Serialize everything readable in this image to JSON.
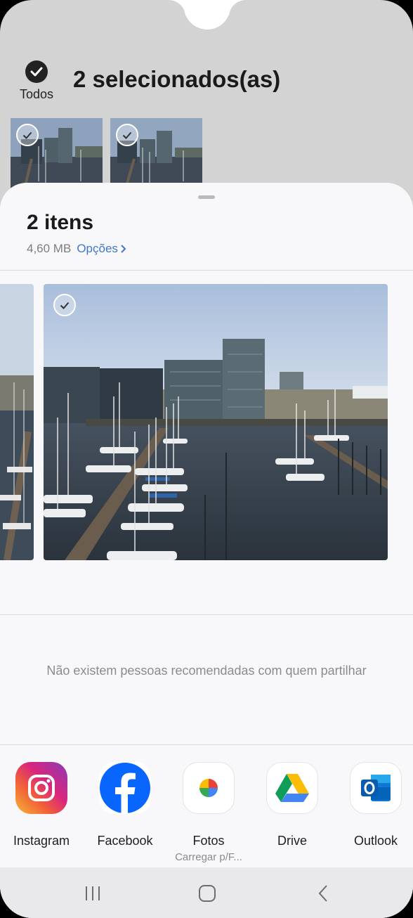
{
  "gallery": {
    "select_all_label": "Todos",
    "selection_title": "2 selecionados(as)"
  },
  "sheet": {
    "title": "2 itens",
    "size": "4,60 MB",
    "options_label": "Opções",
    "no_people_text": "Não existem pessoas recomendadas com quem partilhar"
  },
  "apps": [
    {
      "name": "Instagram",
      "sub": "",
      "icon": "instagram-icon"
    },
    {
      "name": "Facebook",
      "sub": "",
      "icon": "facebook-icon"
    },
    {
      "name": "Fotos",
      "sub": "Carregar p/F...",
      "icon": "google-photos-icon"
    },
    {
      "name": "Drive",
      "sub": "",
      "icon": "google-drive-icon"
    },
    {
      "name": "Outlook",
      "sub": "",
      "icon": "outlook-icon"
    }
  ],
  "colors": {
    "accent": "#3e78c6",
    "background_dim": "#d3d3d3",
    "sheet": "#f8f8fb"
  }
}
